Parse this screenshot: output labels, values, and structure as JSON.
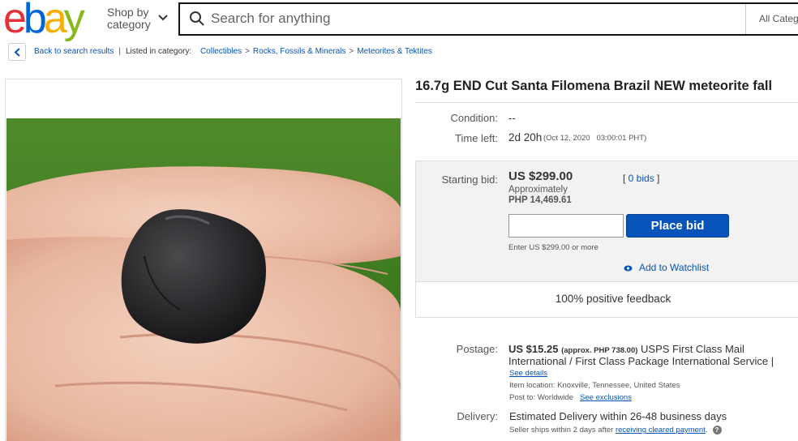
{
  "header": {
    "logo": {
      "e": "e",
      "b": "b",
      "a": "a",
      "y": "y"
    },
    "shop_by_line1": "Shop by",
    "shop_by_line2": "category",
    "search_placeholder": "Search for anything",
    "category_select": "All Categ"
  },
  "breadcrumb": {
    "back_link": "Back to search results",
    "listed_in": "Listed in category:",
    "items": [
      "Collectibles",
      "Rocks, Fossils & Minerals",
      "Meteorites & Tektites"
    ]
  },
  "listing": {
    "title": "16.7g END Cut Santa Filomena Brazil NEW meteorite fall",
    "condition_label": "Condition:",
    "condition_value": "--",
    "time_left_label": "Time left:",
    "time_left_value": "2d 20h",
    "time_left_end": "(Oct 12, 2020   03:00:01 PHT)",
    "starting_bid_label": "Starting bid:",
    "starting_bid_value": "US $299.00",
    "approximately": "Approximately",
    "php_value": "PHP 14,469.61",
    "bids_open": "[ ",
    "bids_link": "0 bids",
    "bids_close": " ]",
    "bid_input_value": "",
    "place_bid": "Place bid",
    "enter_hint": "Enter US $299.00 or more",
    "watchlist": "Add to Watchlist",
    "feedback": "100% positive feedback",
    "postage_label": "Postage:",
    "postage_price": "US $15.25",
    "postage_approx": "(approx. PHP 738.00)",
    "postage_service_1": "USPS First Class Mail",
    "postage_service_2": "International / First Class Package International Service |",
    "see_details": "See details",
    "item_location": "Item location:  Knoxville, Tennessee, United States",
    "post_to": "Post to:  Worldwide",
    "see_exclusions": "See exclusions",
    "delivery_label": "Delivery:",
    "delivery_value": "Estimated Delivery within 26-48 business days",
    "seller_ships": "Seller ships within 2 days after ",
    "receiving_payment": "receiving cleared payment",
    "seller_ships_end": "."
  },
  "colors": {
    "logo_red": "#e53238",
    "logo_blue": "#0064d2",
    "logo_yellow": "#f5af02",
    "logo_green": "#86b817",
    "link_blue": "#0654ba",
    "bid_button": "#0654ba"
  }
}
